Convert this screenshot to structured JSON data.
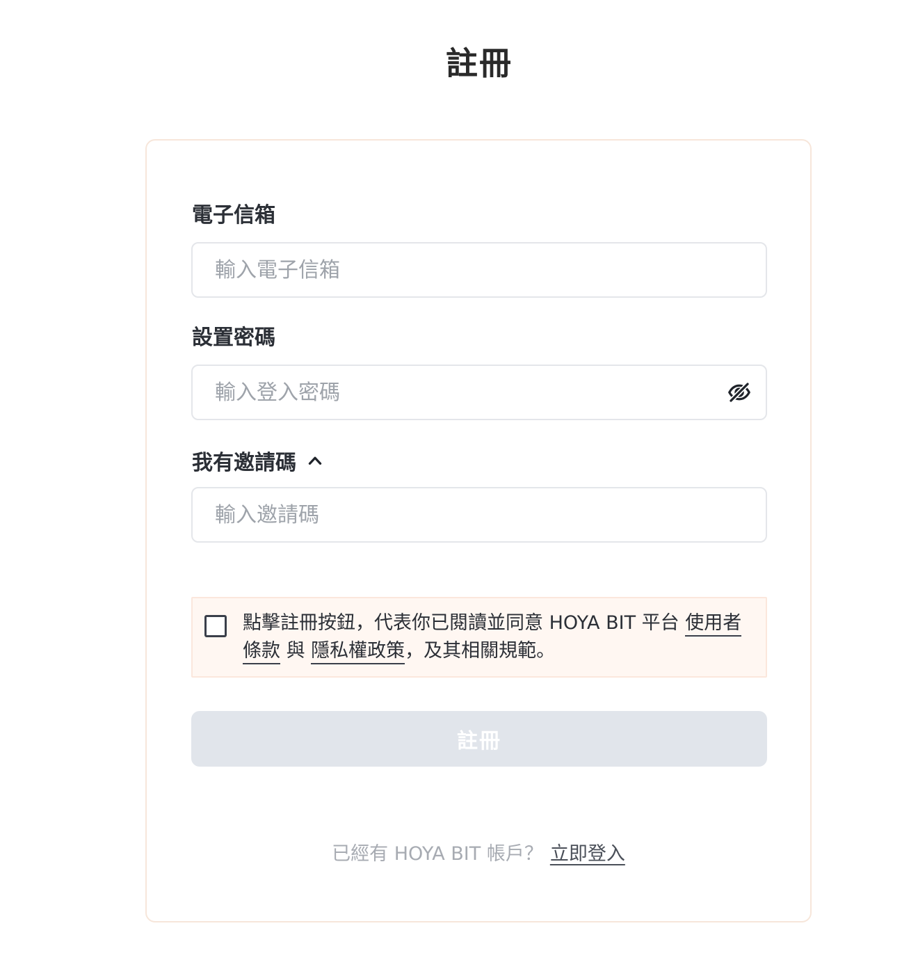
{
  "page": {
    "title": "註冊"
  },
  "form": {
    "email": {
      "label": "電子信箱",
      "placeholder": "輸入電子信箱",
      "value": ""
    },
    "password": {
      "label": "設置密碼",
      "placeholder": "輸入登入密碼",
      "value": "",
      "toggle_icon": "eye-slash-icon"
    },
    "invite": {
      "toggle_label": "我有邀請碼",
      "toggle_icon": "chevron-up-icon",
      "expanded": true,
      "placeholder": "輸入邀請碼",
      "value": ""
    },
    "terms": {
      "checked": false,
      "prefix": "點擊註冊按鈕，代表你已閱讀並同意 HOYA BIT 平台 ",
      "terms_link": "使用者條款",
      "connector": " 與 ",
      "privacy_link": "隱私權政策",
      "suffix": "，及其相關規範。"
    },
    "submit_label": "註冊"
  },
  "footer": {
    "prompt": "已經有 HOYA BIT 帳戶？",
    "login_link": "立即登入"
  },
  "colors": {
    "card_border": "#f7e6da",
    "terms_background": "#fff7f2",
    "button_disabled": "#e1e5eb",
    "placeholder": "#9ea3aa"
  }
}
